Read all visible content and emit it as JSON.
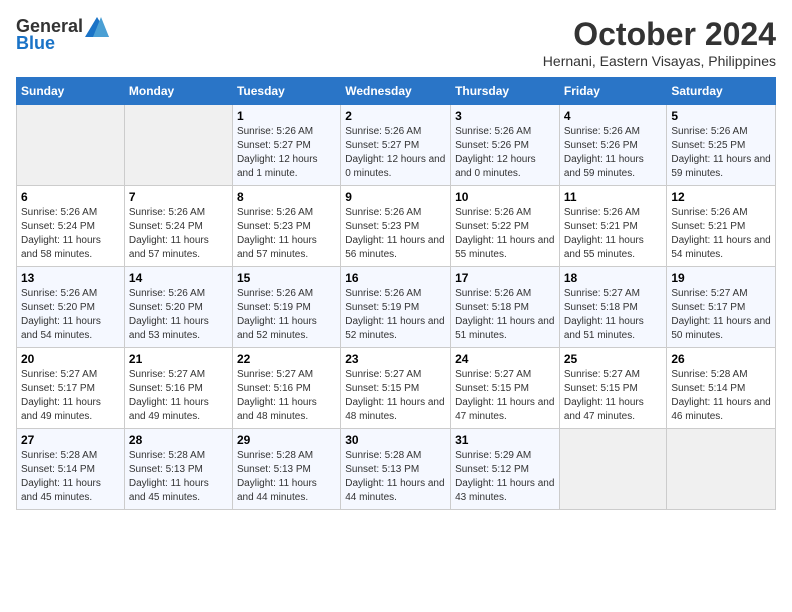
{
  "logo": {
    "general": "General",
    "blue": "Blue"
  },
  "title": "October 2024",
  "location": "Hernani, Eastern Visayas, Philippines",
  "days_of_week": [
    "Sunday",
    "Monday",
    "Tuesday",
    "Wednesday",
    "Thursday",
    "Friday",
    "Saturday"
  ],
  "weeks": [
    [
      {
        "day": "",
        "info": ""
      },
      {
        "day": "",
        "info": ""
      },
      {
        "day": "1",
        "info": "Sunrise: 5:26 AM\nSunset: 5:27 PM\nDaylight: 12 hours and 1 minute."
      },
      {
        "day": "2",
        "info": "Sunrise: 5:26 AM\nSunset: 5:27 PM\nDaylight: 12 hours and 0 minutes."
      },
      {
        "day": "3",
        "info": "Sunrise: 5:26 AM\nSunset: 5:26 PM\nDaylight: 12 hours and 0 minutes."
      },
      {
        "day": "4",
        "info": "Sunrise: 5:26 AM\nSunset: 5:26 PM\nDaylight: 11 hours and 59 minutes."
      },
      {
        "day": "5",
        "info": "Sunrise: 5:26 AM\nSunset: 5:25 PM\nDaylight: 11 hours and 59 minutes."
      }
    ],
    [
      {
        "day": "6",
        "info": "Sunrise: 5:26 AM\nSunset: 5:24 PM\nDaylight: 11 hours and 58 minutes."
      },
      {
        "day": "7",
        "info": "Sunrise: 5:26 AM\nSunset: 5:24 PM\nDaylight: 11 hours and 57 minutes."
      },
      {
        "day": "8",
        "info": "Sunrise: 5:26 AM\nSunset: 5:23 PM\nDaylight: 11 hours and 57 minutes."
      },
      {
        "day": "9",
        "info": "Sunrise: 5:26 AM\nSunset: 5:23 PM\nDaylight: 11 hours and 56 minutes."
      },
      {
        "day": "10",
        "info": "Sunrise: 5:26 AM\nSunset: 5:22 PM\nDaylight: 11 hours and 55 minutes."
      },
      {
        "day": "11",
        "info": "Sunrise: 5:26 AM\nSunset: 5:21 PM\nDaylight: 11 hours and 55 minutes."
      },
      {
        "day": "12",
        "info": "Sunrise: 5:26 AM\nSunset: 5:21 PM\nDaylight: 11 hours and 54 minutes."
      }
    ],
    [
      {
        "day": "13",
        "info": "Sunrise: 5:26 AM\nSunset: 5:20 PM\nDaylight: 11 hours and 54 minutes."
      },
      {
        "day": "14",
        "info": "Sunrise: 5:26 AM\nSunset: 5:20 PM\nDaylight: 11 hours and 53 minutes."
      },
      {
        "day": "15",
        "info": "Sunrise: 5:26 AM\nSunset: 5:19 PM\nDaylight: 11 hours and 52 minutes."
      },
      {
        "day": "16",
        "info": "Sunrise: 5:26 AM\nSunset: 5:19 PM\nDaylight: 11 hours and 52 minutes."
      },
      {
        "day": "17",
        "info": "Sunrise: 5:26 AM\nSunset: 5:18 PM\nDaylight: 11 hours and 51 minutes."
      },
      {
        "day": "18",
        "info": "Sunrise: 5:27 AM\nSunset: 5:18 PM\nDaylight: 11 hours and 51 minutes."
      },
      {
        "day": "19",
        "info": "Sunrise: 5:27 AM\nSunset: 5:17 PM\nDaylight: 11 hours and 50 minutes."
      }
    ],
    [
      {
        "day": "20",
        "info": "Sunrise: 5:27 AM\nSunset: 5:17 PM\nDaylight: 11 hours and 49 minutes."
      },
      {
        "day": "21",
        "info": "Sunrise: 5:27 AM\nSunset: 5:16 PM\nDaylight: 11 hours and 49 minutes."
      },
      {
        "day": "22",
        "info": "Sunrise: 5:27 AM\nSunset: 5:16 PM\nDaylight: 11 hours and 48 minutes."
      },
      {
        "day": "23",
        "info": "Sunrise: 5:27 AM\nSunset: 5:15 PM\nDaylight: 11 hours and 48 minutes."
      },
      {
        "day": "24",
        "info": "Sunrise: 5:27 AM\nSunset: 5:15 PM\nDaylight: 11 hours and 47 minutes."
      },
      {
        "day": "25",
        "info": "Sunrise: 5:27 AM\nSunset: 5:15 PM\nDaylight: 11 hours and 47 minutes."
      },
      {
        "day": "26",
        "info": "Sunrise: 5:28 AM\nSunset: 5:14 PM\nDaylight: 11 hours and 46 minutes."
      }
    ],
    [
      {
        "day": "27",
        "info": "Sunrise: 5:28 AM\nSunset: 5:14 PM\nDaylight: 11 hours and 45 minutes."
      },
      {
        "day": "28",
        "info": "Sunrise: 5:28 AM\nSunset: 5:13 PM\nDaylight: 11 hours and 45 minutes."
      },
      {
        "day": "29",
        "info": "Sunrise: 5:28 AM\nSunset: 5:13 PM\nDaylight: 11 hours and 44 minutes."
      },
      {
        "day": "30",
        "info": "Sunrise: 5:28 AM\nSunset: 5:13 PM\nDaylight: 11 hours and 44 minutes."
      },
      {
        "day": "31",
        "info": "Sunrise: 5:29 AM\nSunset: 5:12 PM\nDaylight: 11 hours and 43 minutes."
      },
      {
        "day": "",
        "info": ""
      },
      {
        "day": "",
        "info": ""
      }
    ]
  ]
}
